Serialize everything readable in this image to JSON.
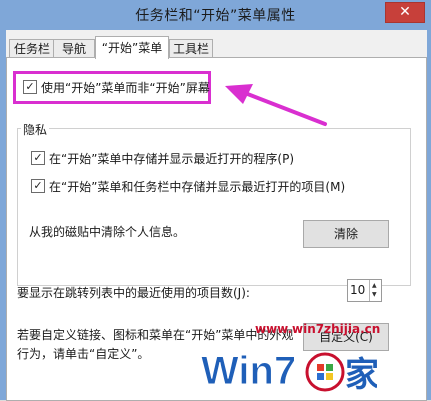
{
  "window": {
    "title": "任务栏和“开始”菜单属性",
    "close_glyph": "✕"
  },
  "tabs": [
    {
      "label": "任务栏"
    },
    {
      "label": "导航"
    },
    {
      "label": "“开始”菜单"
    },
    {
      "label": "工具栏"
    }
  ],
  "start_screen": {
    "label": "使用“开始”菜单而非“开始”屏幕",
    "checked": true
  },
  "privacy": {
    "title": "隐私",
    "store_programs_label": "在“开始”菜单中存储并显示最近打开的程序(P)",
    "store_items_label": "在“开始”菜单和任务栏中存储并显示最近打开的项目(M)",
    "clear_info_text": "从我的磁贴中清除个人信息。",
    "clear_button": "清除"
  },
  "jump_list": {
    "label": "要显示在跳转列表中的最近使用的项目数(J):",
    "value": "10"
  },
  "customize": {
    "text_line1": "若要自定义链接、图标和菜单在“开始”菜单中的外观",
    "text_line2": "行为，请单击“自定义”。",
    "button": "自定义(C)"
  },
  "watermark": {
    "url": "www.win7zhijia.cn",
    "logo_text": "Win7",
    "logo_suffix": "家"
  },
  "colors": {
    "highlight": "#d92fd0",
    "arrow": "#d92fd0",
    "title_bar": "#7fa7d8",
    "close": "#c7403a"
  }
}
